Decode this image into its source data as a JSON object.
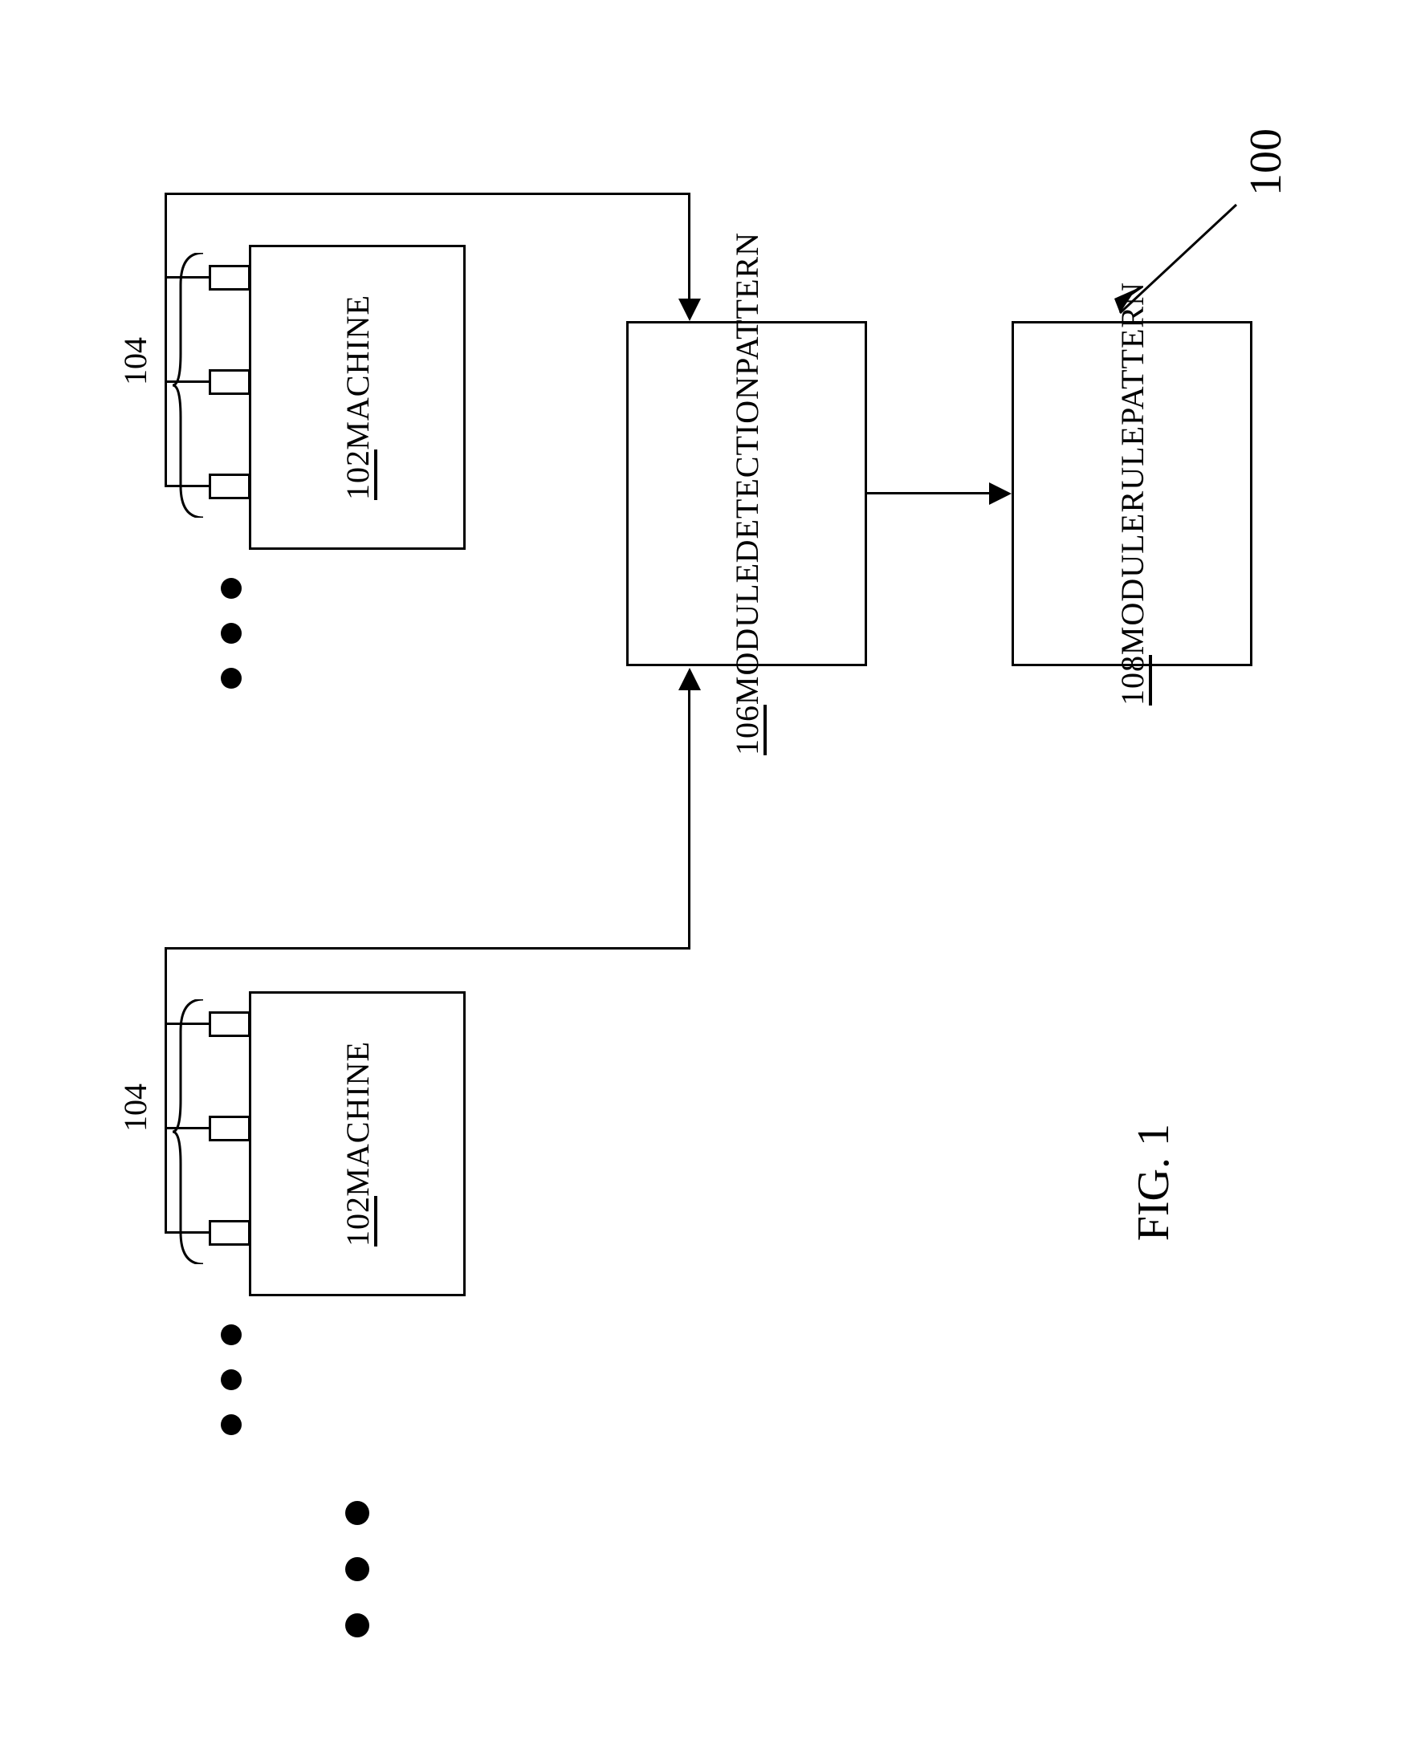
{
  "figure_ref": "100",
  "figure_label": "FIG. 1",
  "machines": {
    "label": "MACHINE",
    "ref": "102"
  },
  "sensors_ref": "104",
  "pattern_detection": {
    "line1": "PATTERN",
    "line2": "DETECTION",
    "line3": "MODULE",
    "ref": "106"
  },
  "pattern_rule": {
    "line1": "PATTERN",
    "line2": "RULE",
    "line3": "MODULE",
    "ref": "108"
  }
}
